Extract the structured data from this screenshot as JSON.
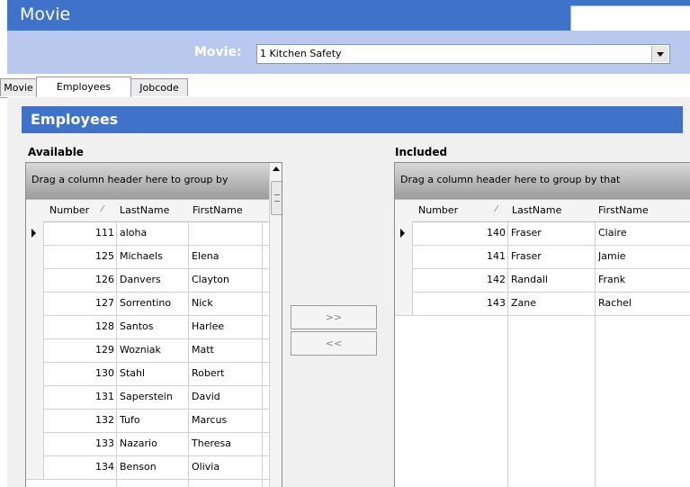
{
  "window": {
    "title": "Movie"
  },
  "movie_selector": {
    "label": "Movie:",
    "value": "1 Kitchen Safety"
  },
  "tabs": [
    {
      "label": "Movie",
      "active": false
    },
    {
      "label": "Employees",
      "active": true
    },
    {
      "label": "Jobcode",
      "active": false
    }
  ],
  "section": {
    "title": "Employees"
  },
  "available": {
    "title": "Available",
    "group_hint": "Drag a column header here to group by",
    "columns": [
      "Number",
      "LastName",
      "FirstName"
    ],
    "rows": [
      {
        "number": "111",
        "last": "aloha",
        "first": ""
      },
      {
        "number": "125",
        "last": "Michaels",
        "first": "Elena"
      },
      {
        "number": "126",
        "last": "Danvers",
        "first": "Clayton"
      },
      {
        "number": "127",
        "last": "Sorrentino",
        "first": "Nick"
      },
      {
        "number": "128",
        "last": "Santos",
        "first": "Harlee"
      },
      {
        "number": "129",
        "last": "Wozniak",
        "first": "Matt"
      },
      {
        "number": "130",
        "last": "Stahl",
        "first": "Robert"
      },
      {
        "number": "131",
        "last": "Saperstein",
        "first": "David"
      },
      {
        "number": "132",
        "last": "Tufo",
        "first": "Marcus"
      },
      {
        "number": "133",
        "last": "Nazario",
        "first": "Theresa"
      },
      {
        "number": "134",
        "last": "Benson",
        "first": "Olivia"
      }
    ]
  },
  "included": {
    "title": "Included",
    "group_hint": "Drag a column header here to group by that",
    "columns": [
      "Number",
      "LastName",
      "FirstName"
    ],
    "rows": [
      {
        "number": "140",
        "last": "Fraser",
        "first": "Claire"
      },
      {
        "number": "141",
        "last": "Fraser",
        "first": "Jamie"
      },
      {
        "number": "142",
        "last": "Randall",
        "first": "Frank"
      },
      {
        "number": "143",
        "last": "Zane",
        "first": "Rachel"
      }
    ]
  },
  "buttons": {
    "add": ">>",
    "remove": "<<"
  },
  "colors": {
    "header_blue": "#3f72c9",
    "selector_bg": "#b9c9ee"
  },
  "icons": [
    "dropdown-arrow-icon",
    "sort-icon",
    "row-pointer-icon",
    "scroll-up-icon"
  ]
}
